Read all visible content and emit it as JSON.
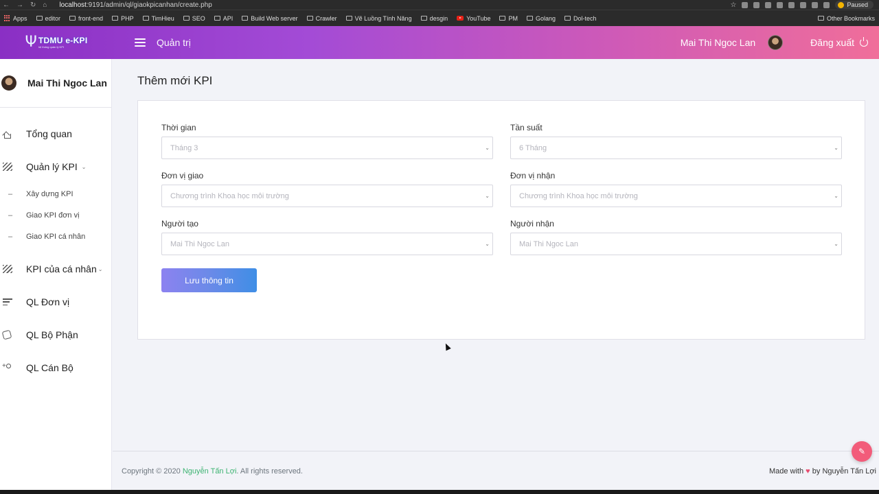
{
  "browser": {
    "url_host": "localhost",
    "url_rest": ":9191/admin/ql/giaokpicanhan/create.php",
    "paused_label": "Paused",
    "bookmarks": [
      "Apps",
      "editor",
      "front-end",
      "PHP",
      "TimHieu",
      "SEO",
      "API",
      "Build Web server",
      "Crawler",
      "Vẽ Luồng Tính Năng",
      "desgin",
      "YouTube",
      "PM",
      "Golang",
      "Dol-tech"
    ],
    "other_bookmarks": "Other Bookmarks"
  },
  "header": {
    "logo_text": "TDMU e-KPI",
    "logo_tagline": "hệ thống quản lý KPI",
    "section_title": "Quản trị",
    "username": "Mai Thi Ngoc Lan",
    "logout_label": "Đăng xuất"
  },
  "sidebar": {
    "profile_name": "Mai Thi Ngoc Lan",
    "items": [
      {
        "label": "Tổng quan"
      },
      {
        "label": "Quản lý KPI",
        "sub": [
          "Xây dựng KPI",
          "Giao KPI đơn vị",
          "Giao KPI cá nhân"
        ]
      },
      {
        "label": "KPI của cá nhân"
      },
      {
        "label": "QL Đơn vị"
      },
      {
        "label": "QL Bộ Phận"
      },
      {
        "label": "QL Cán Bộ"
      }
    ]
  },
  "page": {
    "title": "Thêm mới KPI",
    "fields": {
      "thoi_gian": {
        "label": "Thời gian",
        "value": "Tháng 3"
      },
      "tan_suat": {
        "label": "Tần suất",
        "value": "6 Tháng"
      },
      "don_vi_giao": {
        "label": "Đơn vị giao",
        "value": "Chương trình Khoa học môi trường"
      },
      "don_vi_nhan": {
        "label": "Đơn vị nhận",
        "value": "Chương trình Khoa học môi trường"
      },
      "nguoi_tao": {
        "label": "Người tạo",
        "value": "Mai Thi Ngoc Lan"
      },
      "nguoi_nhan": {
        "label": "Người nhận",
        "value": "Mai Thi Ngoc Lan"
      }
    },
    "save_label": "Lưu thông tin"
  },
  "footer": {
    "copyright_prefix": "Copyright © 2020",
    "author": "Nguyễn Tấn Lợi",
    "copyright_suffix": ". All rights reserved.",
    "made_with_prefix": "Made with",
    "made_with_suffix": "by Nguyễn Tấn Lợi"
  },
  "colors": {
    "header_gradient_start": "#8a2fc4",
    "header_gradient_end": "#f06e9a",
    "button_start": "#8c82f0",
    "button_end": "#3f8ee6",
    "author_link": "#3cb371"
  }
}
